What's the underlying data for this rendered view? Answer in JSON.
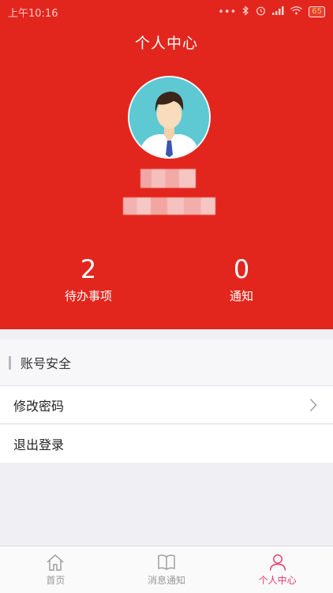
{
  "status": {
    "time": "上午10:16",
    "battery": "65"
  },
  "header": {
    "title": "个人中心",
    "stats": [
      {
        "value": "2",
        "label": "待办事项"
      },
      {
        "value": "0",
        "label": "通知"
      }
    ]
  },
  "section": {
    "title": "账号安全"
  },
  "menu": [
    {
      "label": "修改密码"
    },
    {
      "label": "退出登录"
    }
  ],
  "tabs": [
    {
      "label": "首页",
      "icon": "home-icon"
    },
    {
      "label": "消息通知",
      "icon": "book-icon"
    },
    {
      "label": "个人中心",
      "icon": "person-icon"
    }
  ],
  "colors": {
    "brand": "#e2261d",
    "active_tab": "#e8376a"
  }
}
